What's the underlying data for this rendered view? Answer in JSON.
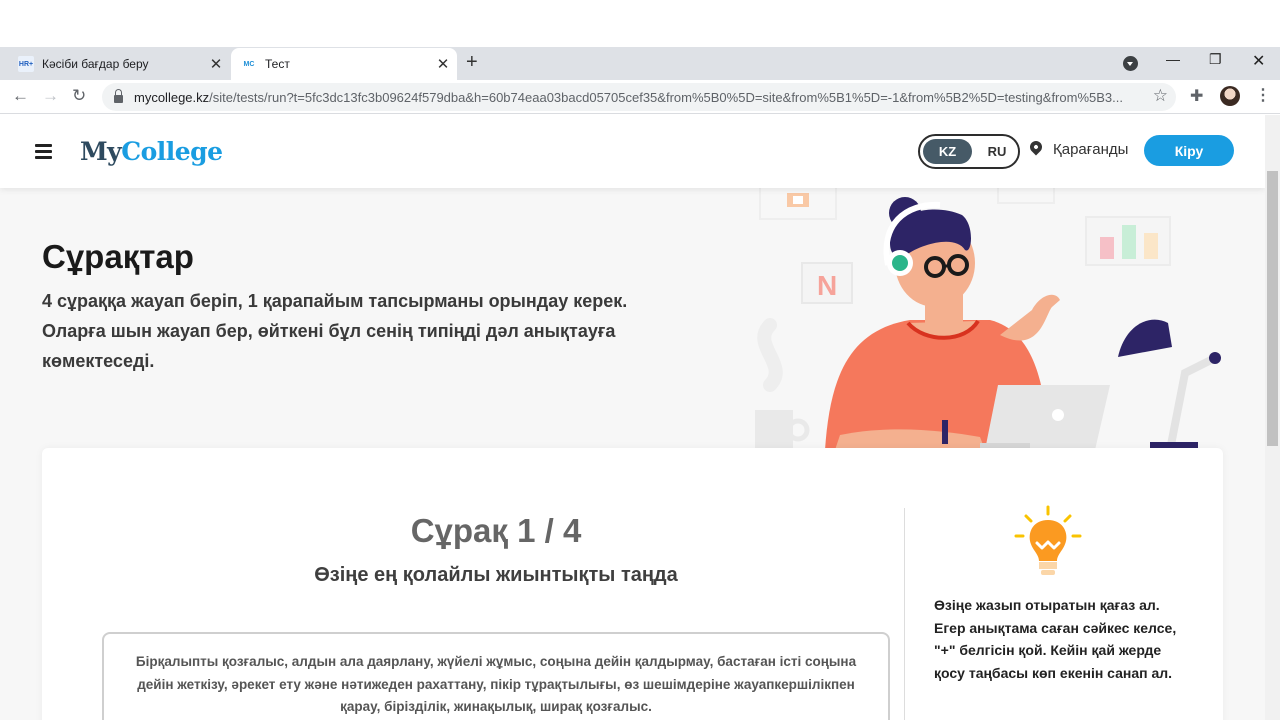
{
  "browser": {
    "tabs": [
      {
        "favicon": "HR+",
        "title": "Кәсіби бағдар беру"
      },
      {
        "favicon": "MC",
        "title": "Тест"
      }
    ],
    "url_domain": "mycollege.kz",
    "url_path": "/site/tests/run?t=5fc3dc13fc3b09624f579dba&h=60b74eaa03bacd05705cef35&from%5B0%5D=site&from%5B1%5D=-1&from%5B2%5D=testing&from%5B3..."
  },
  "header": {
    "logo_part1": "My",
    "logo_part2": "College",
    "lang_kz": "KZ",
    "lang_ru": "RU",
    "city": "Қарағанды",
    "login_label": "Кіру"
  },
  "hero": {
    "title": "Сұрақтар",
    "description": "4 сұраққа жауап беріп, 1 қарапайым тапсырманы орындау керек. Оларға шын жауап бер, өйткені бұл сенің типіңді дәл анықтауға көмектеседі."
  },
  "question": {
    "counter": "Сұрақ 1 / 4",
    "subtitle": "Өзіңе ең қолайлы жиынтықты таңда",
    "option_1": "Бірқалыпты қозғалыс, алдын ала даярлану, жүйелі жұмыс, соңына дейін қалдырмау, бастаған істі соңына дейін жеткізу, әрекет ету және нәтижеден рахаттану, пікір тұрақтылығы, өз шешімдеріне жауапкершілікпен қарау, біріздiлік, жинақылық, ширақ қозғалыс."
  },
  "hint": {
    "text": "Өзіңе жазып отыратын қағаз ал. Егер анықтама саған сәйкес келсе, \"+\" белгісін қой. Кейін қай жерде қосу таңбасы көп екенін санап ал."
  },
  "colors": {
    "brand_dark": "#2e4a5f",
    "brand_blue": "#1a9de1",
    "lang_active": "#465a67"
  }
}
